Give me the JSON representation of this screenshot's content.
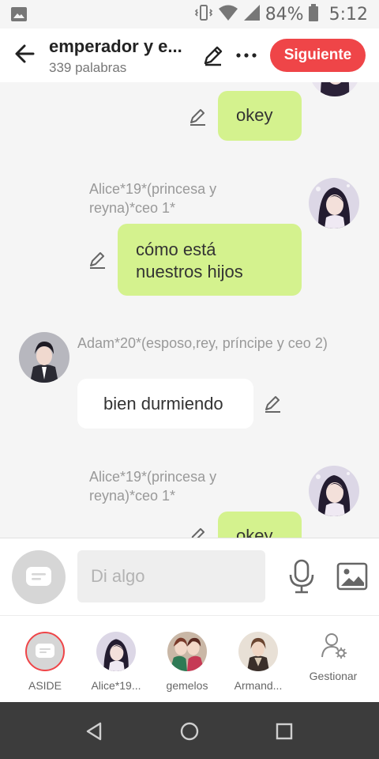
{
  "status_bar": {
    "battery_percent": "84%",
    "time": "5:12"
  },
  "header": {
    "title": "emperador y e...",
    "word_count": "339 palabras",
    "next_label": "Siguiente"
  },
  "messages": [
    {
      "side": "me",
      "text": "okey"
    },
    {
      "side": "me",
      "name": "Alice*19*(princesa y reyna)*ceo 1*",
      "text": "cómo está nuestros hijos"
    },
    {
      "side": "other",
      "name": "Adam*20*(esposo,rey, príncipe y ceo 2)",
      "text": "bien durmiendo"
    },
    {
      "side": "me",
      "name": "Alice*19*(princesa y reyna)*ceo 1*",
      "text": "okey"
    }
  ],
  "composer": {
    "placeholder": "Di algo"
  },
  "characters": [
    {
      "label": "ASIDE"
    },
    {
      "label": "Alice*19..."
    },
    {
      "label": "gemelos"
    },
    {
      "label": "Armand..."
    },
    {
      "label": "Gestionar"
    }
  ],
  "colors": {
    "accent": "#ef4548",
    "bubble_me": "#d4f28e",
    "bubble_other": "#ffffff",
    "navbar": "#3c3c3c"
  },
  "icons": {
    "back": "arrow-left-icon",
    "edit": "pencil-icon",
    "more": "more-dots-icon",
    "mic": "microphone-icon",
    "image": "image-icon",
    "manage": "person-gear-icon"
  }
}
